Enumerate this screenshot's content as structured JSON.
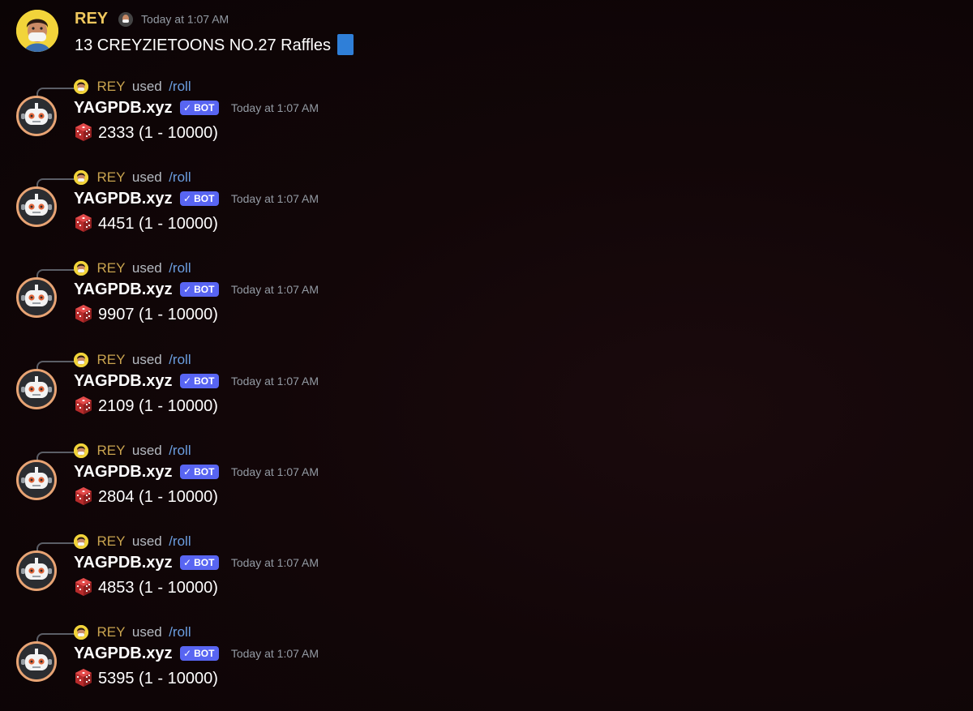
{
  "first_message": {
    "username": "REY",
    "timestamp": "Today at 1:07 AM",
    "text": "13 CREYZIETOONS NO.27 Raffles",
    "emoji": "blue-square"
  },
  "replies": [
    {
      "ref_user": "REY",
      "ref_used": "used",
      "ref_cmd": "/roll",
      "bot_name": "YAGPDB.xyz",
      "badge": "BOT",
      "timestamp": "Today at 1:07 AM",
      "result": "2333 (1 - 10000)"
    },
    {
      "ref_user": "REY",
      "ref_used": "used",
      "ref_cmd": "/roll",
      "bot_name": "YAGPDB.xyz",
      "badge": "BOT",
      "timestamp": "Today at 1:07 AM",
      "result": "4451 (1 - 10000)"
    },
    {
      "ref_user": "REY",
      "ref_used": "used",
      "ref_cmd": "/roll",
      "bot_name": "YAGPDB.xyz",
      "badge": "BOT",
      "timestamp": "Today at 1:07 AM",
      "result": "9907 (1 - 10000)"
    },
    {
      "ref_user": "REY",
      "ref_used": "used",
      "ref_cmd": "/roll",
      "bot_name": "YAGPDB.xyz",
      "badge": "BOT",
      "timestamp": "Today at 1:07 AM",
      "result": "2109 (1 - 10000)"
    },
    {
      "ref_user": "REY",
      "ref_used": "used",
      "ref_cmd": "/roll",
      "bot_name": "YAGPDB.xyz",
      "badge": "BOT",
      "timestamp": "Today at 1:07 AM",
      "result": "2804 (1 - 10000)"
    },
    {
      "ref_user": "REY",
      "ref_used": "used",
      "ref_cmd": "/roll",
      "bot_name": "YAGPDB.xyz",
      "badge": "BOT",
      "timestamp": "Today at 1:07 AM",
      "result": "4853 (1 - 10000)"
    },
    {
      "ref_user": "REY",
      "ref_used": "used",
      "ref_cmd": "/roll",
      "bot_name": "YAGPDB.xyz",
      "badge": "BOT",
      "timestamp": "Today at 1:07 AM",
      "result": "5395 (1 - 10000)"
    }
  ],
  "colors": {
    "background": "#120608",
    "username_rey": "#f0c85e",
    "command_link": "#6b9ee0",
    "bot_badge": "#5865f2",
    "bot_avatar_ring": "#e8a474",
    "die": "#d83a3a"
  },
  "icons": {
    "die": "game-die-icon",
    "badge_check": "checkmark-icon",
    "emoji": "blue-square-icon"
  }
}
